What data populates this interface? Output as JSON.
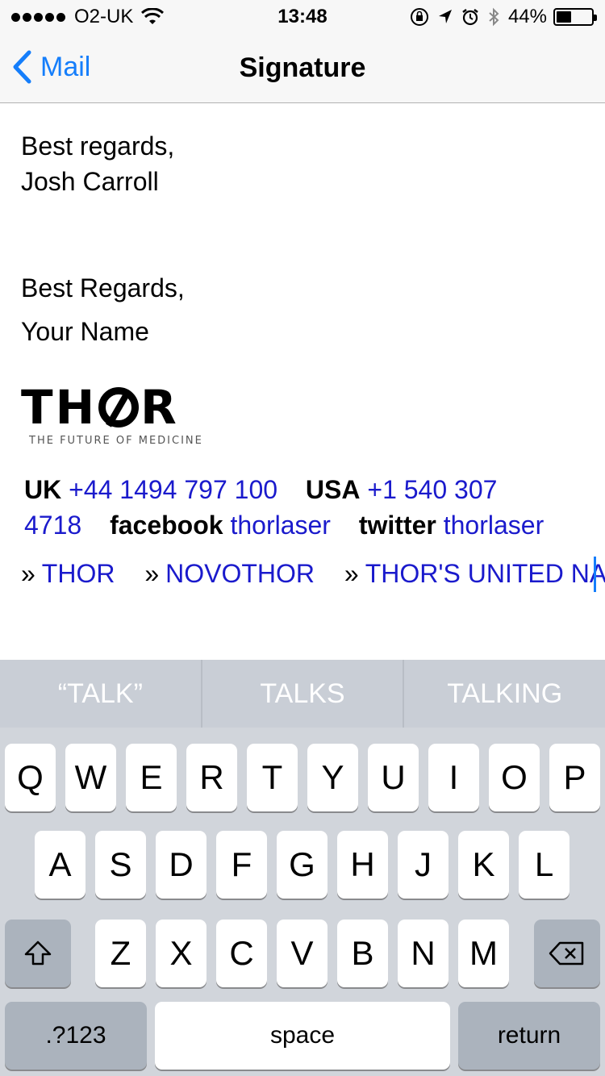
{
  "status_bar": {
    "carrier": "O2-UK",
    "time": "13:48",
    "battery": "44%",
    "battery_level": 0.44
  },
  "nav": {
    "back_label": "Mail",
    "title": "Signature"
  },
  "signature": {
    "line1": "Best regards,",
    "line2": "Josh Carroll",
    "line3": "Best Regards,",
    "line4": "Your Name",
    "logo_text": "THOR",
    "logo_tagline": "THE FUTURE OF MEDICINE",
    "uk_label": "UK",
    "uk_phone": "+44 1494 797 100",
    "usa_label": "USA",
    "usa_phone_part1": "+1 540 307",
    "usa_phone_part2": "4718",
    "facebook_label": "facebook",
    "facebook_handle": "thorlaser",
    "twitter_label": "twitter",
    "twitter_handle": "thorlaser",
    "link_prefix": "»",
    "links": [
      "THOR",
      "NOVOTHOR",
      "THOR'S UNITED NA"
    ]
  },
  "keyboard": {
    "suggestions": [
      "“TALK”",
      "TALKS",
      "TALKING"
    ],
    "row1": [
      "Q",
      "W",
      "E",
      "R",
      "T",
      "Y",
      "U",
      "I",
      "O",
      "P"
    ],
    "row2": [
      "A",
      "S",
      "D",
      "F",
      "G",
      "H",
      "J",
      "K",
      "L"
    ],
    "row3": [
      "Z",
      "X",
      "C",
      "V",
      "B",
      "N",
      "M"
    ],
    "numbers_label": ".?123",
    "space_label": "space",
    "return_label": "return"
  },
  "colors": {
    "ios_blue": "#157efb",
    "link_blue": "#1a1acc",
    "keyboard_bg": "#d1d5db"
  }
}
